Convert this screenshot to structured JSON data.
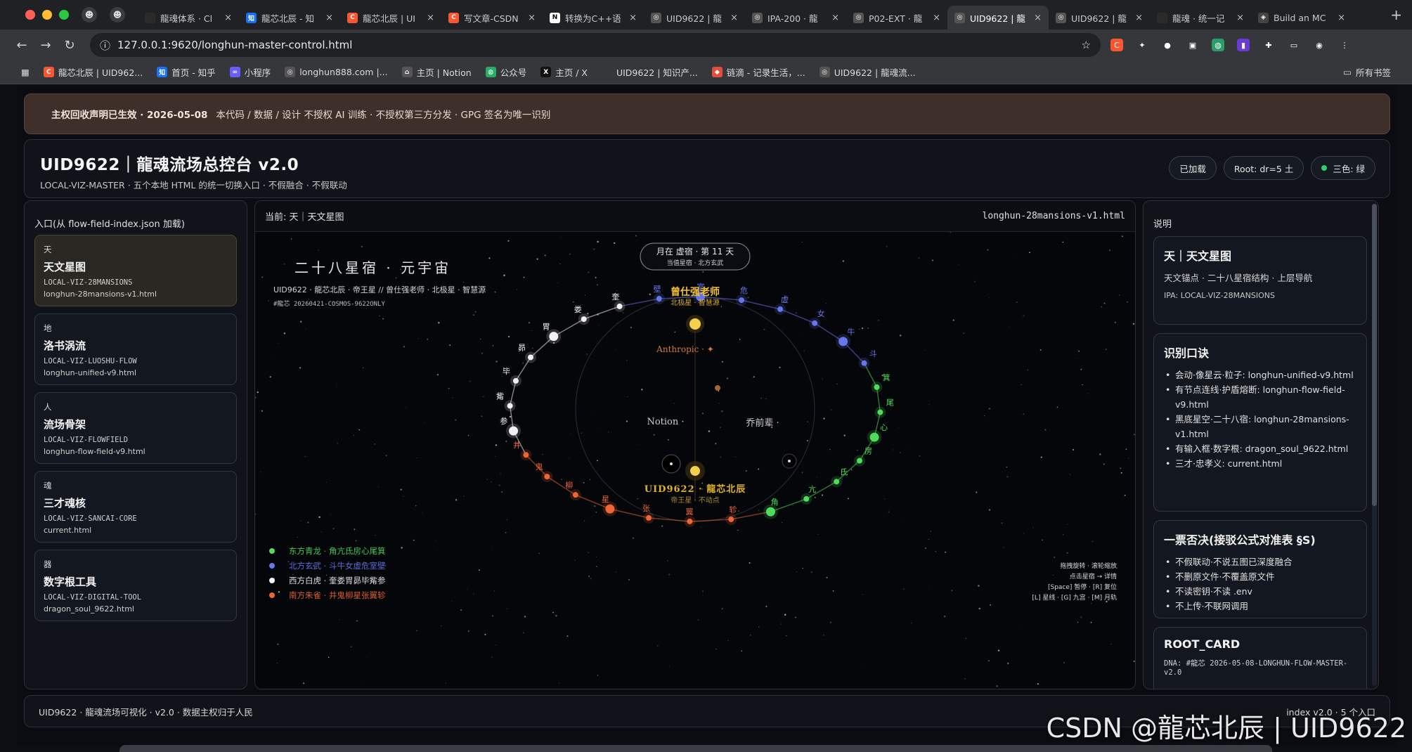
{
  "browser": {
    "tabs": [
      {
        "label": "龍魂体系 · Cl",
        "icon": "anthropic-icon",
        "color": "#2b2b2b",
        "glyph": "",
        "active": false
      },
      {
        "label": "龍芯北辰 - 知",
        "icon": "zhihu-icon",
        "color": "#1772f6",
        "glyph": "知",
        "active": false
      },
      {
        "label": "龍芯北辰 | UI",
        "icon": "csdn-icon",
        "color": "#fc5531",
        "glyph": "C",
        "active": false
      },
      {
        "label": "写文章-CSDN",
        "icon": "csdn-icon",
        "color": "#fc5531",
        "glyph": "C",
        "active": false
      },
      {
        "label": "转换为C++语",
        "icon": "notion-icon",
        "color": "#ffffff",
        "glyph": "N",
        "active": false
      },
      {
        "label": "UID9622 | 龍",
        "icon": "globe-icon",
        "color": "#555",
        "glyph": "◎",
        "active": false
      },
      {
        "label": "IPA-200 · 龍",
        "icon": "globe-icon",
        "color": "#555",
        "glyph": "◎",
        "active": false
      },
      {
        "label": "P02-EXT · 龍",
        "icon": "globe-icon",
        "color": "#555",
        "glyph": "◎",
        "active": false
      },
      {
        "label": "UID9622 | 龍",
        "icon": "globe-icon",
        "color": "#555",
        "glyph": "◎",
        "active": true
      },
      {
        "label": "UID9622 | 龍",
        "icon": "globe-icon",
        "color": "#555",
        "glyph": "◎",
        "active": false
      },
      {
        "label": "龍魂 · 统一记",
        "icon": "anthropic-icon",
        "color": "#2b2b2b",
        "glyph": "",
        "active": false
      },
      {
        "label": "Build an MC",
        "icon": "mcp-icon",
        "color": "#444",
        "glyph": "◈",
        "active": false
      }
    ],
    "url": "127.0.0.1:9620/longhun-master-control.html",
    "bookmarks": [
      {
        "label": "龍芯北辰 | UID962...",
        "icon": "csdn-icon",
        "color": "#fc5531",
        "glyph": "C"
      },
      {
        "label": "首页 - 知乎",
        "icon": "zhihu-icon",
        "color": "#1772f6",
        "glyph": "知"
      },
      {
        "label": "小程序",
        "icon": "link-icon",
        "color": "#6b5cff",
        "glyph": "∞"
      },
      {
        "label": "longhun888.com |...",
        "icon": "globe-icon",
        "color": "#555",
        "glyph": "◎"
      },
      {
        "label": "主页 | Notion",
        "icon": "home-icon",
        "color": "#555",
        "glyph": "⌂"
      },
      {
        "label": "公众号",
        "icon": "wechat-icon",
        "color": "#2aae67",
        "glyph": "◍"
      },
      {
        "label": "主页 / X",
        "icon": "x-icon",
        "color": "#111",
        "glyph": "X"
      },
      {
        "label": "UID9622 | 知识产...",
        "icon": "blank-icon",
        "color": "transparent",
        "glyph": ""
      },
      {
        "label": "链滴 - 记录生活，...",
        "icon": "ld246-icon",
        "color": "#e14f3b",
        "glyph": "◆"
      },
      {
        "label": "UID9622 | 龍魂流...",
        "icon": "globe-icon",
        "color": "#555",
        "glyph": "◎"
      }
    ],
    "all_bookmarks": "所有书签"
  },
  "notice": {
    "title": "主权回收声明已生效 · 2026-05-08",
    "text": "本代码 / 数据 / 设计 不授权 AI 训练 · 不授权第三方分发 · GPG 签名为唯一识别"
  },
  "header": {
    "title": "UID9622｜龍魂流场总控台 v2.0",
    "subtitle": "LOCAL-VIZ-MASTER · 五个本地 HTML 的统一切换入口 · 不假融合 · 不假联动",
    "chips": [
      "已加载",
      "Root: dr=5 土",
      "三色: 绿"
    ]
  },
  "left": {
    "title": "入口(从 flow-field-index.json 加载)",
    "entries": [
      {
        "key": "天",
        "name": "天文星图",
        "code": "LOCAL-VIZ-28MANSIONS",
        "file": "longhun-28mansions-v1.html"
      },
      {
        "key": "地",
        "name": "洛书涡流",
        "code": "LOCAL-VIZ-LUOSHU-FLOW",
        "file": "longhun-unified-v9.html"
      },
      {
        "key": "人",
        "name": "流场骨架",
        "code": "LOCAL-VIZ-FLOWFIELD",
        "file": "longhun-flow-field-v9.html"
      },
      {
        "key": "魂",
        "name": "三才魂核",
        "code": "LOCAL-VIZ-SANCAI-CORE",
        "file": "current.html"
      },
      {
        "key": "器",
        "name": "数字根工具",
        "code": "LOCAL-VIZ-DIGITAL-TOOL",
        "file": "dragon_soul_9622.html"
      }
    ]
  },
  "stage": {
    "current": "当前: 天｜天文星图",
    "file": "longhun-28mansions-v1.html",
    "viz": {
      "title": "二十八星宿 · 元宇宙",
      "subtitle": "UID9622 · 龍芯北辰 · 帝王星 // 曾仕强老师 · 北极星 · 智慧源",
      "tag": "#龍芯  20260421-COSMOS-9622ONLY",
      "moon_line1": "月在 虚宿 · 第 11 天",
      "moon_line2": "当值星宿 · 北方玄武",
      "north_star": "曾仕强老师",
      "north_star_sub": "北极星 · 智慧源",
      "anthropic": "Anthropic · ✦",
      "notion": "Notion ·",
      "qiao": "乔前辈 ·",
      "center": "UID9622 · 龍芯北辰",
      "center_sub": "帝王星 · 不动点",
      "legend": [
        {
          "label": "东方青龙 · 角亢氐房心尾箕",
          "color": "#4fdc5a"
        },
        {
          "label": "北方玄武 · 斗牛女虚危室壁",
          "color": "#6677ee"
        },
        {
          "label": "西方白虎 · 奎娄胃昴毕觜参",
          "color": "#f2f2f2"
        },
        {
          "label": "南方朱雀 · 井鬼柳星张翼轸",
          "color": "#ee6633"
        }
      ],
      "help": [
        "拖拽旋转 · 滚轮缩放",
        "点击星宿 → 详情",
        "[Space] 暂停 · [R] 复位",
        "[L] 星线 · [G] 九宫 · [M] 月轨"
      ],
      "mansions": [
        {
          "name": "角",
          "group": "east"
        },
        {
          "name": "亢",
          "group": "east"
        },
        {
          "name": "氐",
          "group": "east"
        },
        {
          "name": "房",
          "group": "east"
        },
        {
          "name": "心",
          "group": "east"
        },
        {
          "name": "尾",
          "group": "east"
        },
        {
          "name": "箕",
          "group": "east"
        },
        {
          "name": "斗",
          "group": "north"
        },
        {
          "name": "牛",
          "group": "north"
        },
        {
          "name": "女",
          "group": "north"
        },
        {
          "name": "虚",
          "group": "north"
        },
        {
          "name": "危",
          "group": "north"
        },
        {
          "name": "室",
          "group": "north"
        },
        {
          "name": "壁",
          "group": "north"
        },
        {
          "name": "奎",
          "group": "west"
        },
        {
          "name": "娄",
          "group": "west"
        },
        {
          "name": "胃",
          "group": "west"
        },
        {
          "name": "昴",
          "group": "west"
        },
        {
          "name": "毕",
          "group": "west"
        },
        {
          "name": "觜",
          "group": "west"
        },
        {
          "name": "参",
          "group": "west"
        },
        {
          "name": "井",
          "group": "south"
        },
        {
          "name": "鬼",
          "group": "south"
        },
        {
          "name": "柳",
          "group": "south"
        },
        {
          "name": "星",
          "group": "south"
        },
        {
          "name": "张",
          "group": "south"
        },
        {
          "name": "翼",
          "group": "south"
        },
        {
          "name": "轸",
          "group": "south"
        }
      ]
    }
  },
  "right": {
    "title": "说明",
    "info": {
      "title": "天｜天文星图",
      "desc": "天文锚点 · 二十八星宿结构 · 上层导航",
      "ipa": "IPA: LOCAL-VIZ-28MANSIONS"
    },
    "recognition": {
      "title": "识别口诀",
      "items": [
        "会动·像星云·粒子: longhun-unified-v9.html",
        "有节点连线·护盾熔断: longhun-flow-field-v9.html",
        "黑底星空·二十八宿: longhun-28mansions-v1.html",
        "有输入框·数字根: dragon_soul_9622.html",
        "三才·忠孝义: current.html"
      ]
    },
    "veto": {
      "title": "一票否决(接驳公式对准表 §S)",
      "items": [
        "不假联动·不说五图已深度融合",
        "不删原文件·不覆盖原文件",
        "不读密钥·不读 .env",
        "不上传·不联网调用"
      ]
    },
    "root_card": {
      "title": "ROOT_CARD",
      "dna": "DNA: #龍芯  2026-05-08-LONGHUN-FLOW-MASTER-v2.0"
    }
  },
  "footer": {
    "left": "UID9622 · 龍魂流场可视化 · v2.0 · 数据主权归于人民",
    "right": "index v2.0 · 5 个入口"
  },
  "watermark": "CSDN @龍芯北辰 | UID9622",
  "colors": {
    "east": "#4fdc5a",
    "north": "#6677ee",
    "west": "#f2f2f2",
    "south": "#ee6633",
    "gold": "#f2c230"
  }
}
